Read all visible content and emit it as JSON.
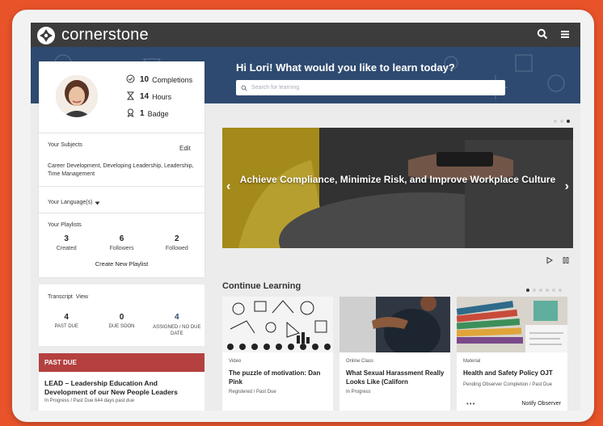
{
  "brand": {
    "name": "cornerstone"
  },
  "hero": {
    "greeting": "Hi Lori! What would you like to learn today?",
    "search_placeholder": "Search for learning"
  },
  "profile": {
    "stats": [
      {
        "value": "10",
        "label": "Completions",
        "icon": "check-circle-icon"
      },
      {
        "value": "14",
        "label": "Hours",
        "icon": "hourglass-icon"
      },
      {
        "value": "1",
        "label": "Badge",
        "icon": "badge-icon"
      }
    ],
    "subjects_title": "Your Subjects",
    "subjects_edit": "Edit",
    "subjects_text": "Career Development, Developing Leadership, Leadership, Time Management",
    "language_label": "Your Language(s)",
    "playlists_title": "Your Playlists",
    "playlists": [
      {
        "value": "3",
        "label": "Created"
      },
      {
        "value": "6",
        "label": "Followers"
      },
      {
        "value": "2",
        "label": "Followed"
      }
    ],
    "create_playlist": "Create New Playlist"
  },
  "transcript": {
    "title": "Transcript",
    "view": "View",
    "items": [
      {
        "value": "4",
        "label": "PAST DUE"
      },
      {
        "value": "0",
        "label": "DUE SOON"
      },
      {
        "value": "4",
        "label": "ASSIGNED / NO DUE DATE"
      }
    ]
  },
  "past_due": {
    "header": "PAST DUE",
    "item_title": "LEAD – Leadership Education And Development of our New People Leaders",
    "item_meta": "In Progress / Past Due   644 days past due"
  },
  "carousel": {
    "text": "Achieve Compliance, Minimize Risk, and Improve Workplace Culture"
  },
  "continue": {
    "title": "Continue Learning",
    "courses": [
      {
        "type": "Video",
        "title": "The puzzle of motivation: Dan Pink",
        "status": "Registered / Past Due",
        "action": ""
      },
      {
        "type": "Online Class",
        "title": "What Sexual Harassment Really Looks Like (Californ",
        "status": "In Progress",
        "action": ""
      },
      {
        "type": "Material",
        "title": "Health and Safety Policy OJT",
        "status": "Pending Observer Completion / Past Due",
        "action": "Notify Observer"
      }
    ]
  },
  "colors": {
    "accent": "#e8532a",
    "topbar": "#3c3c3c",
    "hero": "#2e4a70",
    "past_due": "#b54040"
  }
}
